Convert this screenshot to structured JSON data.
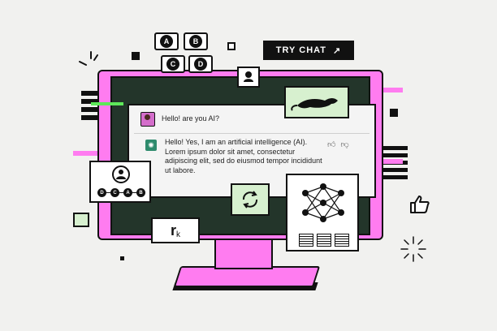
{
  "try_chat": {
    "label": "TRY CHAT",
    "arrow": "↗"
  },
  "choice_keys": [
    "A",
    "B",
    "C",
    "D"
  ],
  "flow_nodes": [
    "D",
    "C",
    "A",
    "B"
  ],
  "chat": {
    "user_message": "Hello! are you AI?",
    "ai_message": "Hello! Yes, I am an artificial intelligence (AI). Lorem ipsum dolor sit amet, consectetur adipiscing elit, sed do eiusmod tempor incididunt ut labore.",
    "feedback_icons": [
      "thumbs-up-icon",
      "thumbs-down-icon"
    ]
  },
  "formula_card": {
    "base": "r",
    "subscript": "k"
  },
  "colors": {
    "accent": "#ff7cf0",
    "screen": "#23352a",
    "card_green": "#d7f0cf",
    "ai_avatar": "#2e8b6d"
  }
}
